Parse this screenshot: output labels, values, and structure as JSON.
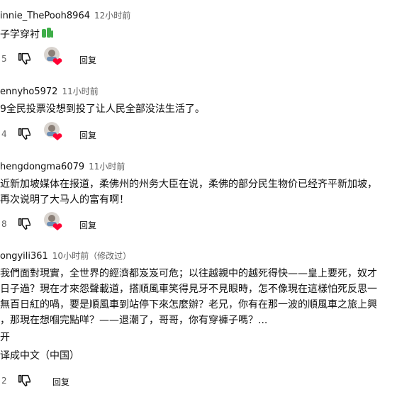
{
  "comments": [
    {
      "author": "innie_ThePooh8964",
      "time": "12小时前",
      "lines": [
        "子学穿衬"
      ],
      "emoji": "gif-icon",
      "likes": "5",
      "reply": "回复"
    },
    {
      "author": "ennyho5972",
      "time": "11小时前",
      "lines": [
        "9全民投票没想到投了让人民全部没法生活了。"
      ],
      "likes": "4",
      "reply": "回复"
    },
    {
      "author": "hengdongma6079",
      "time": "11小时前",
      "lines": [
        "近新加坡媒体在报道，柔佛州的州务大臣在说，柔佛的部分民生物价已经齐平新加坡，",
        "再次说明了大马人的富有啊！"
      ],
      "likes": "8",
      "reply": "回复"
    },
    {
      "author": "ongyili361",
      "time": "10小时前（修改过）",
      "lines": [
        "我們面對現實，全世界的經濟都岌岌可危；以往越親中的越死得快——皇上要死，奴才",
        "日子過？現在才來怨聲載道，搭順風車笑得見牙不見眼時，怎不像現在這樣怕死反思一",
        "無百日紅的喎，要是順風車到站停下來怎麼辦？老兄，你有在那一波的順風車之旅上興",
        "，那現在想嗰完點咩？——退潮了，哥哥，你有穿褲子嗎？..."
      ],
      "read_more": "开",
      "translate": "译成中文（中国）",
      "likes": "2",
      "reply": "回复"
    }
  ],
  "colors": {
    "secondary_text": "#606060",
    "heart": "#ff0033",
    "green_emoji": "#3fae49"
  }
}
